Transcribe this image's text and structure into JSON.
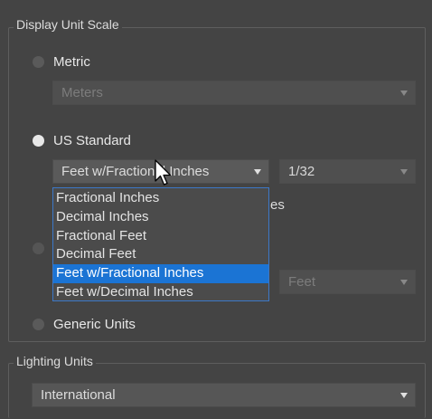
{
  "display_unit_scale": {
    "title": "Display Unit Scale",
    "metric": {
      "label": "Metric",
      "checked": false,
      "dropdown_value": "Meters"
    },
    "us_standard": {
      "label": "US Standard",
      "checked": true,
      "unit_dropdown_value": "Feet w/Fractional Inches",
      "fraction_dropdown_value": "1/32",
      "unit_options": [
        "Fractional Inches",
        "Decimal Inches",
        "Fractional Feet",
        "Decimal Feet",
        "Feet w/Fractional Inches",
        "Feet w/Decimal Inches"
      ],
      "selected_option_index": 4,
      "hidden_trailing_text": "es"
    },
    "custom": {
      "checked": false,
      "dropdown_value": "Feet"
    },
    "generic": {
      "label": "Generic Units",
      "checked": false
    }
  },
  "lighting_units": {
    "title": "Lighting Units",
    "dropdown_value": "International"
  }
}
